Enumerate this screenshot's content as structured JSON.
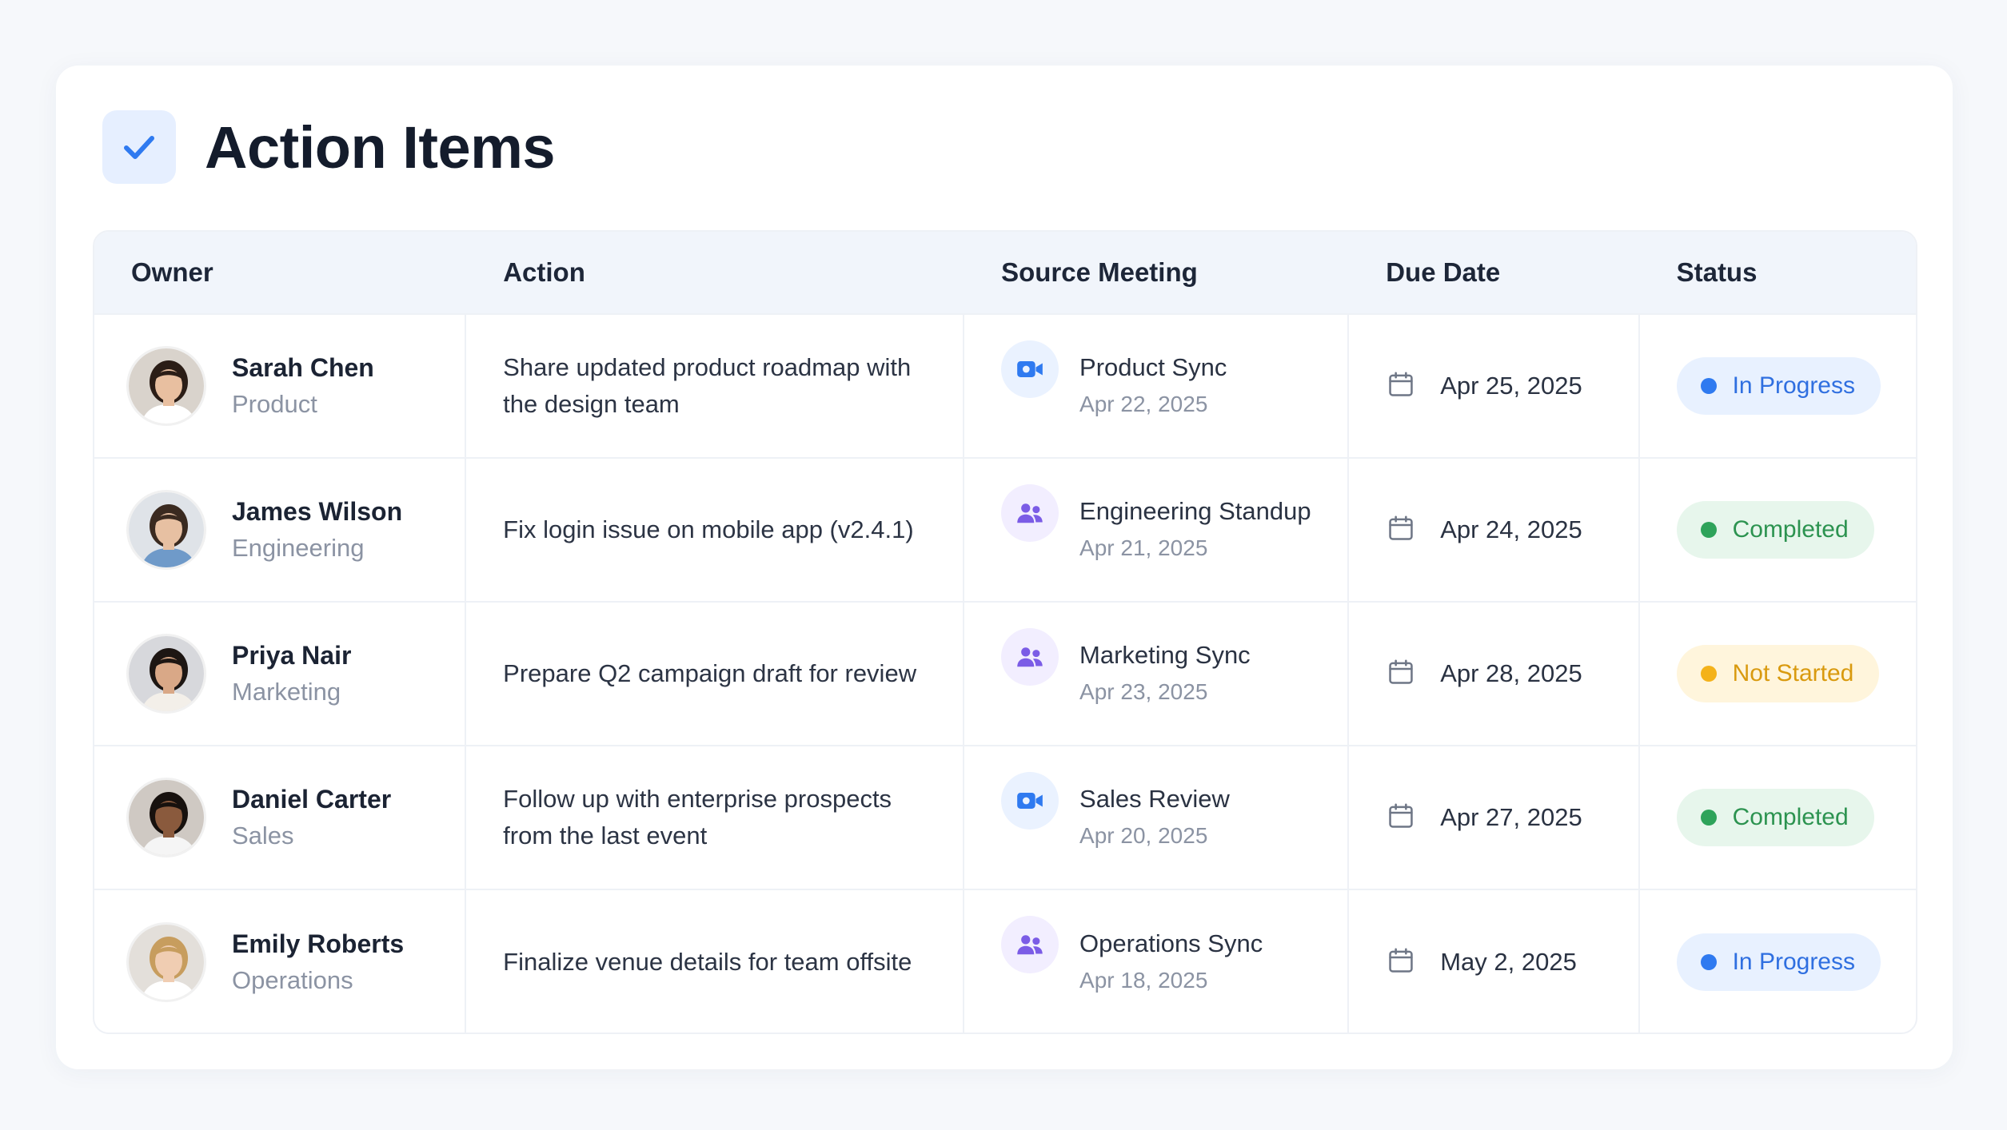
{
  "page": {
    "title": "Action Items",
    "icon": "check-icon",
    "accent": "#2f7af0"
  },
  "table": {
    "columns": [
      "Owner",
      "Action",
      "Source Meeting",
      "Due Date",
      "Status"
    ],
    "rows": [
      {
        "owner": "Sarah Chen",
        "dept": "Product",
        "action": "Share updated product roadmap with the design team",
        "source": "Product Sync",
        "source_date": "Apr 22, 2025",
        "source_icon": "video-camera-icon",
        "due": "Apr 25, 2025",
        "status": "In Progress"
      },
      {
        "owner": "James Wilson",
        "dept": "Engineering",
        "action": "Fix login issue on mobile app (v2.4.1)",
        "source": "Engineering Standup",
        "source_date": "Apr 21, 2025",
        "source_icon": "people-icon",
        "due": "Apr 24, 2025",
        "status": "Completed"
      },
      {
        "owner": "Priya Nair",
        "dept": "Marketing",
        "action": "Prepare Q2 campaign draft for review",
        "source": "Marketing Sync",
        "source_date": "Apr 23, 2025",
        "source_icon": "people-icon",
        "due": "Apr 28, 2025",
        "status": "Not Started"
      },
      {
        "owner": "Daniel Carter",
        "dept": "Sales",
        "action": "Follow up with enterprise prospects from the last event",
        "source": "Sales Review",
        "source_date": "Apr 20, 2025",
        "source_icon": "video-camera-icon",
        "due": "Apr 27, 2025",
        "status": "Completed"
      },
      {
        "owner": "Emily Roberts",
        "dept": "Operations",
        "action": "Finalize venue details for team offsite",
        "source": "Operations Sync",
        "source_date": "Apr 18, 2025",
        "source_icon": "people-icon",
        "due": "May 2, 2025",
        "status": "In Progress"
      }
    ]
  },
  "status_colors": {
    "In Progress": "#2f7af0",
    "Completed": "#2ea35a",
    "Not Started": "#f4b21a"
  }
}
